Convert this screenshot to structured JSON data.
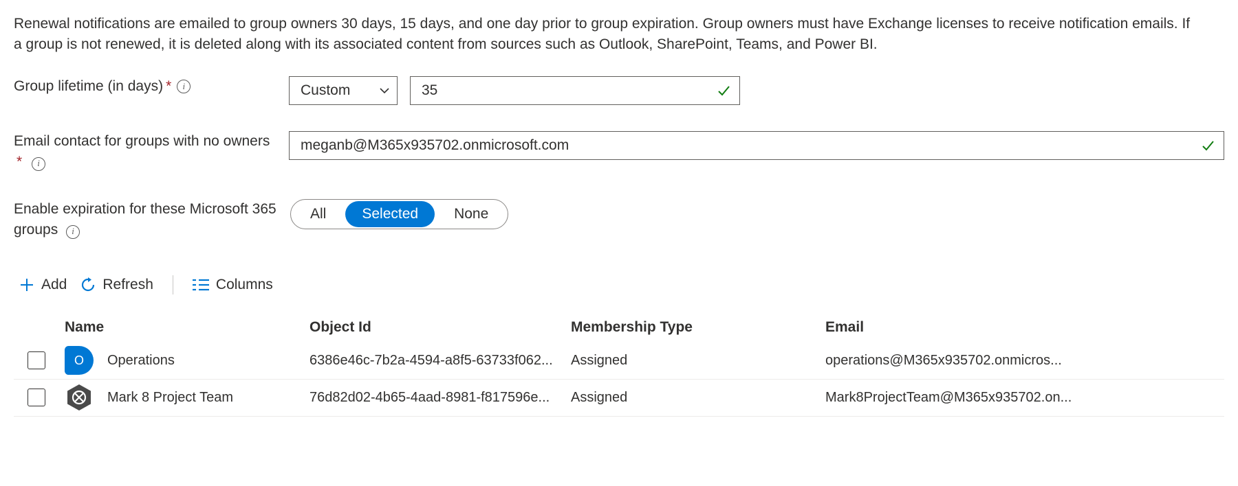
{
  "intro": "Renewal notifications are emailed to group owners 30 days, 15 days, and one day prior to group expiration. Group owners must have Exchange licenses to receive notification emails. If a group is not renewed, it is deleted along with its associated content from sources such as Outlook, SharePoint, Teams, and Power BI.",
  "form": {
    "lifetime_label": "Group lifetime (in days)",
    "lifetime_mode": "Custom",
    "lifetime_value": "35",
    "email_label": "Email contact for groups with no owners",
    "email_value": "meganb@M365x935702.onmicrosoft.com",
    "enable_label": "Enable expiration for these Microsoft 365 groups",
    "toggle": {
      "all": "All",
      "selected": "Selected",
      "none": "None"
    }
  },
  "toolbar": {
    "add": "Add",
    "refresh": "Refresh",
    "columns": "Columns"
  },
  "table": {
    "headers": {
      "name": "Name",
      "objid": "Object Id",
      "mtype": "Membership Type",
      "email": "Email"
    },
    "rows": [
      {
        "name": "Operations",
        "objid": "6386e46c-7b2a-4594-a8f5-63733f062...",
        "mtype": "Assigned",
        "email": "operations@M365x935702.onmicros..."
      },
      {
        "name": "Mark 8 Project Team",
        "objid": "76d82d02-4b65-4aad-8981-f817596e...",
        "mtype": "Assigned",
        "email": "Mark8ProjectTeam@M365x935702.on..."
      }
    ]
  }
}
